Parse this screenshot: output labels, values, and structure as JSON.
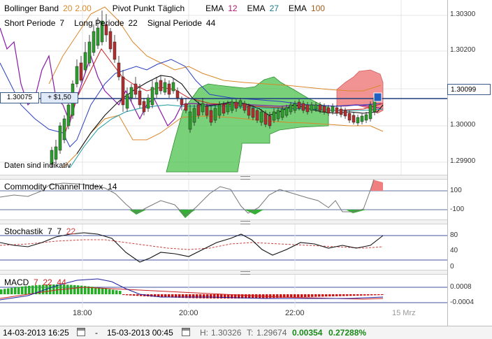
{
  "main_legend": {
    "row1": [
      {
        "text": "Bollinger Band",
        "color": "#000000"
      },
      {
        "text": "20",
        "color": "#d9892b"
      },
      {
        "text": "2.00",
        "color": "#d9892b"
      },
      {
        "text": "Pivot Punkt",
        "color": "#000000"
      },
      {
        "text": "Täglich",
        "color": "#000000"
      },
      {
        "text": "EMA",
        "color": "#000000"
      },
      {
        "text": "12",
        "color": "#b0186e"
      },
      {
        "text": "EMA",
        "color": "#000000"
      },
      {
        "text": "27",
        "color": "#1a7a8a"
      },
      {
        "text": "EMA",
        "color": "#000000"
      },
      {
        "text": "100",
        "color": "#a06020"
      }
    ],
    "row2": [
      {
        "text": "Short Periode",
        "color": "#000000"
      },
      {
        "text": "7",
        "color": "#000000"
      },
      {
        "text": "Long Periode",
        "color": "#000000"
      },
      {
        "text": "22",
        "color": "#000000"
      },
      {
        "text": "Signal Periode",
        "color": "#000000"
      },
      {
        "text": "44",
        "color": "#000000"
      }
    ],
    "data_note": "Daten sind indikativ"
  },
  "price_axis": {
    "labels": [
      "1.30300",
      "1.30200",
      "1.30000",
      "1.29900"
    ],
    "current_price": "1.30099",
    "crosshair_price": "1.30075",
    "crosshair_delta": "+ $1,50"
  },
  "cci": {
    "title": "Commodity Channel Index",
    "period": "14",
    "levels": [
      "100",
      "-100"
    ]
  },
  "stoch": {
    "title": "Stochastik",
    "k": "7",
    "d": "7",
    "smooth": "22",
    "levels": [
      "80",
      "40",
      "0"
    ]
  },
  "macd": {
    "title": "MACD",
    "fast": "7",
    "slow": "22",
    "signal": "44",
    "levels": [
      "0.0008",
      "-0.0004"
    ]
  },
  "time_axis": {
    "labels": [
      "18:00",
      "20:00",
      "22:00",
      "15 Mrz"
    ]
  },
  "status_bar": {
    "start": "14-03-2013 16:25",
    "separator": "-",
    "end": "15-03-2013 00:45",
    "high_label": "H:",
    "high": "1.30326",
    "low_label": "T:",
    "low": "1.29674",
    "change": "0.00354",
    "change_pct": "0.27288%",
    "change_color": "#1a8a1a"
  },
  "colors": {
    "cloud_green": "#4cc24c",
    "cloud_red": "#f08080",
    "candle_up": "#2e9e2e",
    "candle_down": "#b03030",
    "macd_up": "#22b022",
    "macd_down": "#cc1010",
    "line_blue": "#1f3f7f"
  }
}
